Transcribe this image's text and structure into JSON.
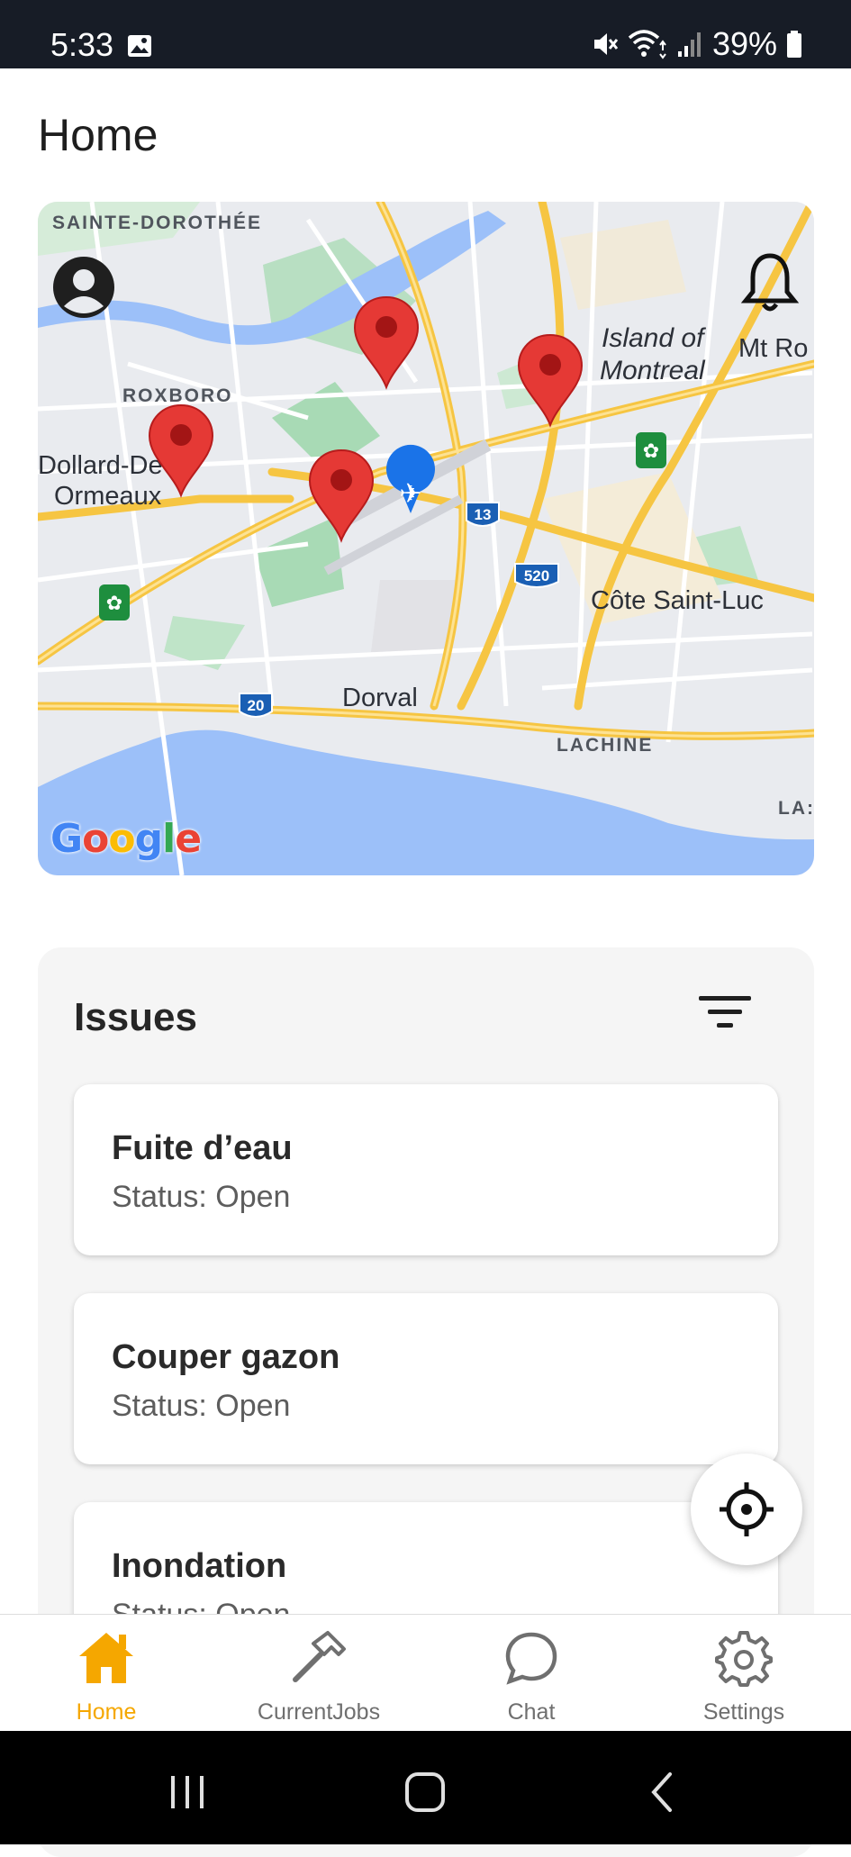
{
  "status_bar": {
    "time": "5:33",
    "battery": "39%",
    "icons": [
      "image-icon",
      "mute-icon",
      "wifi-icon",
      "signal-icon",
      "battery-icon"
    ]
  },
  "header": {
    "title": "Home"
  },
  "map": {
    "labels": {
      "sainte_dorothee": "SAINTE-DOROTHÉE",
      "roxboro": "ROXBORO",
      "dollard_line1": "Dollard-De",
      "dollard_line2": "Ormeaux",
      "island_line1": "Island of",
      "island_line2": "Montreal",
      "mt_ro": "Mt Ro",
      "cote_saint_luc": "Côte Saint-Luc",
      "dorval": "Dorval",
      "lachine": "LACHINE",
      "la": "LA:"
    },
    "route_shields": {
      "r13": "13",
      "r520": "520",
      "r20": "20"
    },
    "google": [
      "G",
      "o",
      "o",
      "g",
      "l",
      "e"
    ],
    "pins": 5,
    "colors": {
      "pin": "#e53935",
      "water": "#9cc0f9",
      "park": "#a8dab5",
      "highway": "#f6c542"
    }
  },
  "issues": {
    "title": "Issues",
    "items": [
      {
        "name": "Fuite d’eau",
        "status": "Status: Open"
      },
      {
        "name": "Couper gazon",
        "status": "Status: Open"
      },
      {
        "name": "Inondation",
        "status": "Status: Open"
      }
    ]
  },
  "bottom_nav": {
    "items": [
      {
        "label": "Home",
        "icon": "home-icon",
        "active": true
      },
      {
        "label": "CurrentJobs",
        "icon": "hammer-icon",
        "active": false
      },
      {
        "label": "Chat",
        "icon": "chat-icon",
        "active": false
      },
      {
        "label": "Settings",
        "icon": "gear-icon",
        "active": false
      }
    ],
    "accent_color": "#f5a700"
  },
  "system_nav": [
    "recents-icon",
    "home-circle-icon",
    "back-icon"
  ]
}
